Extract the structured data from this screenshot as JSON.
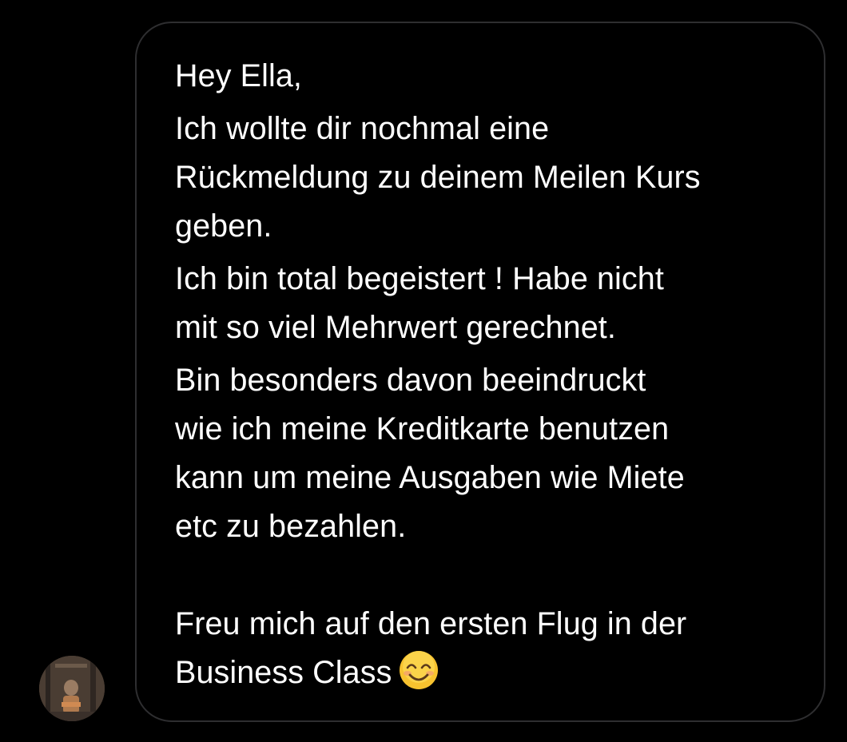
{
  "conversation": {
    "avatar": {
      "icon": "profile-photo-avatar"
    },
    "message": {
      "paragraphs": [
        {
          "lines": [
            "Hey Ella,"
          ]
        },
        {
          "lines": [
            "Ich wollte dir nochmal eine",
            "Rückmeldung zu deinem Meilen Kurs",
            "geben."
          ]
        },
        {
          "lines": [
            "Ich bin total begeistert ! Habe nicht",
            "mit so viel Mehrwert gerechnet."
          ]
        },
        {
          "lines": [
            "Bin besonders davon beeindruckt",
            "wie ich meine Kreditkarte benutzen",
            "kann um meine Ausgaben wie Miete",
            "etc zu bezahlen."
          ]
        },
        {
          "lines": [
            "Freu mich auf den ersten Flug in der",
            "Business Class"
          ]
        }
      ],
      "emoji": "smiling-face-with-smiling-eyes-icon"
    }
  },
  "colors": {
    "background": "#000000",
    "bubble_border": "#2e2e30",
    "text": "#ffffff",
    "emoji_face": "#f7c22f"
  }
}
